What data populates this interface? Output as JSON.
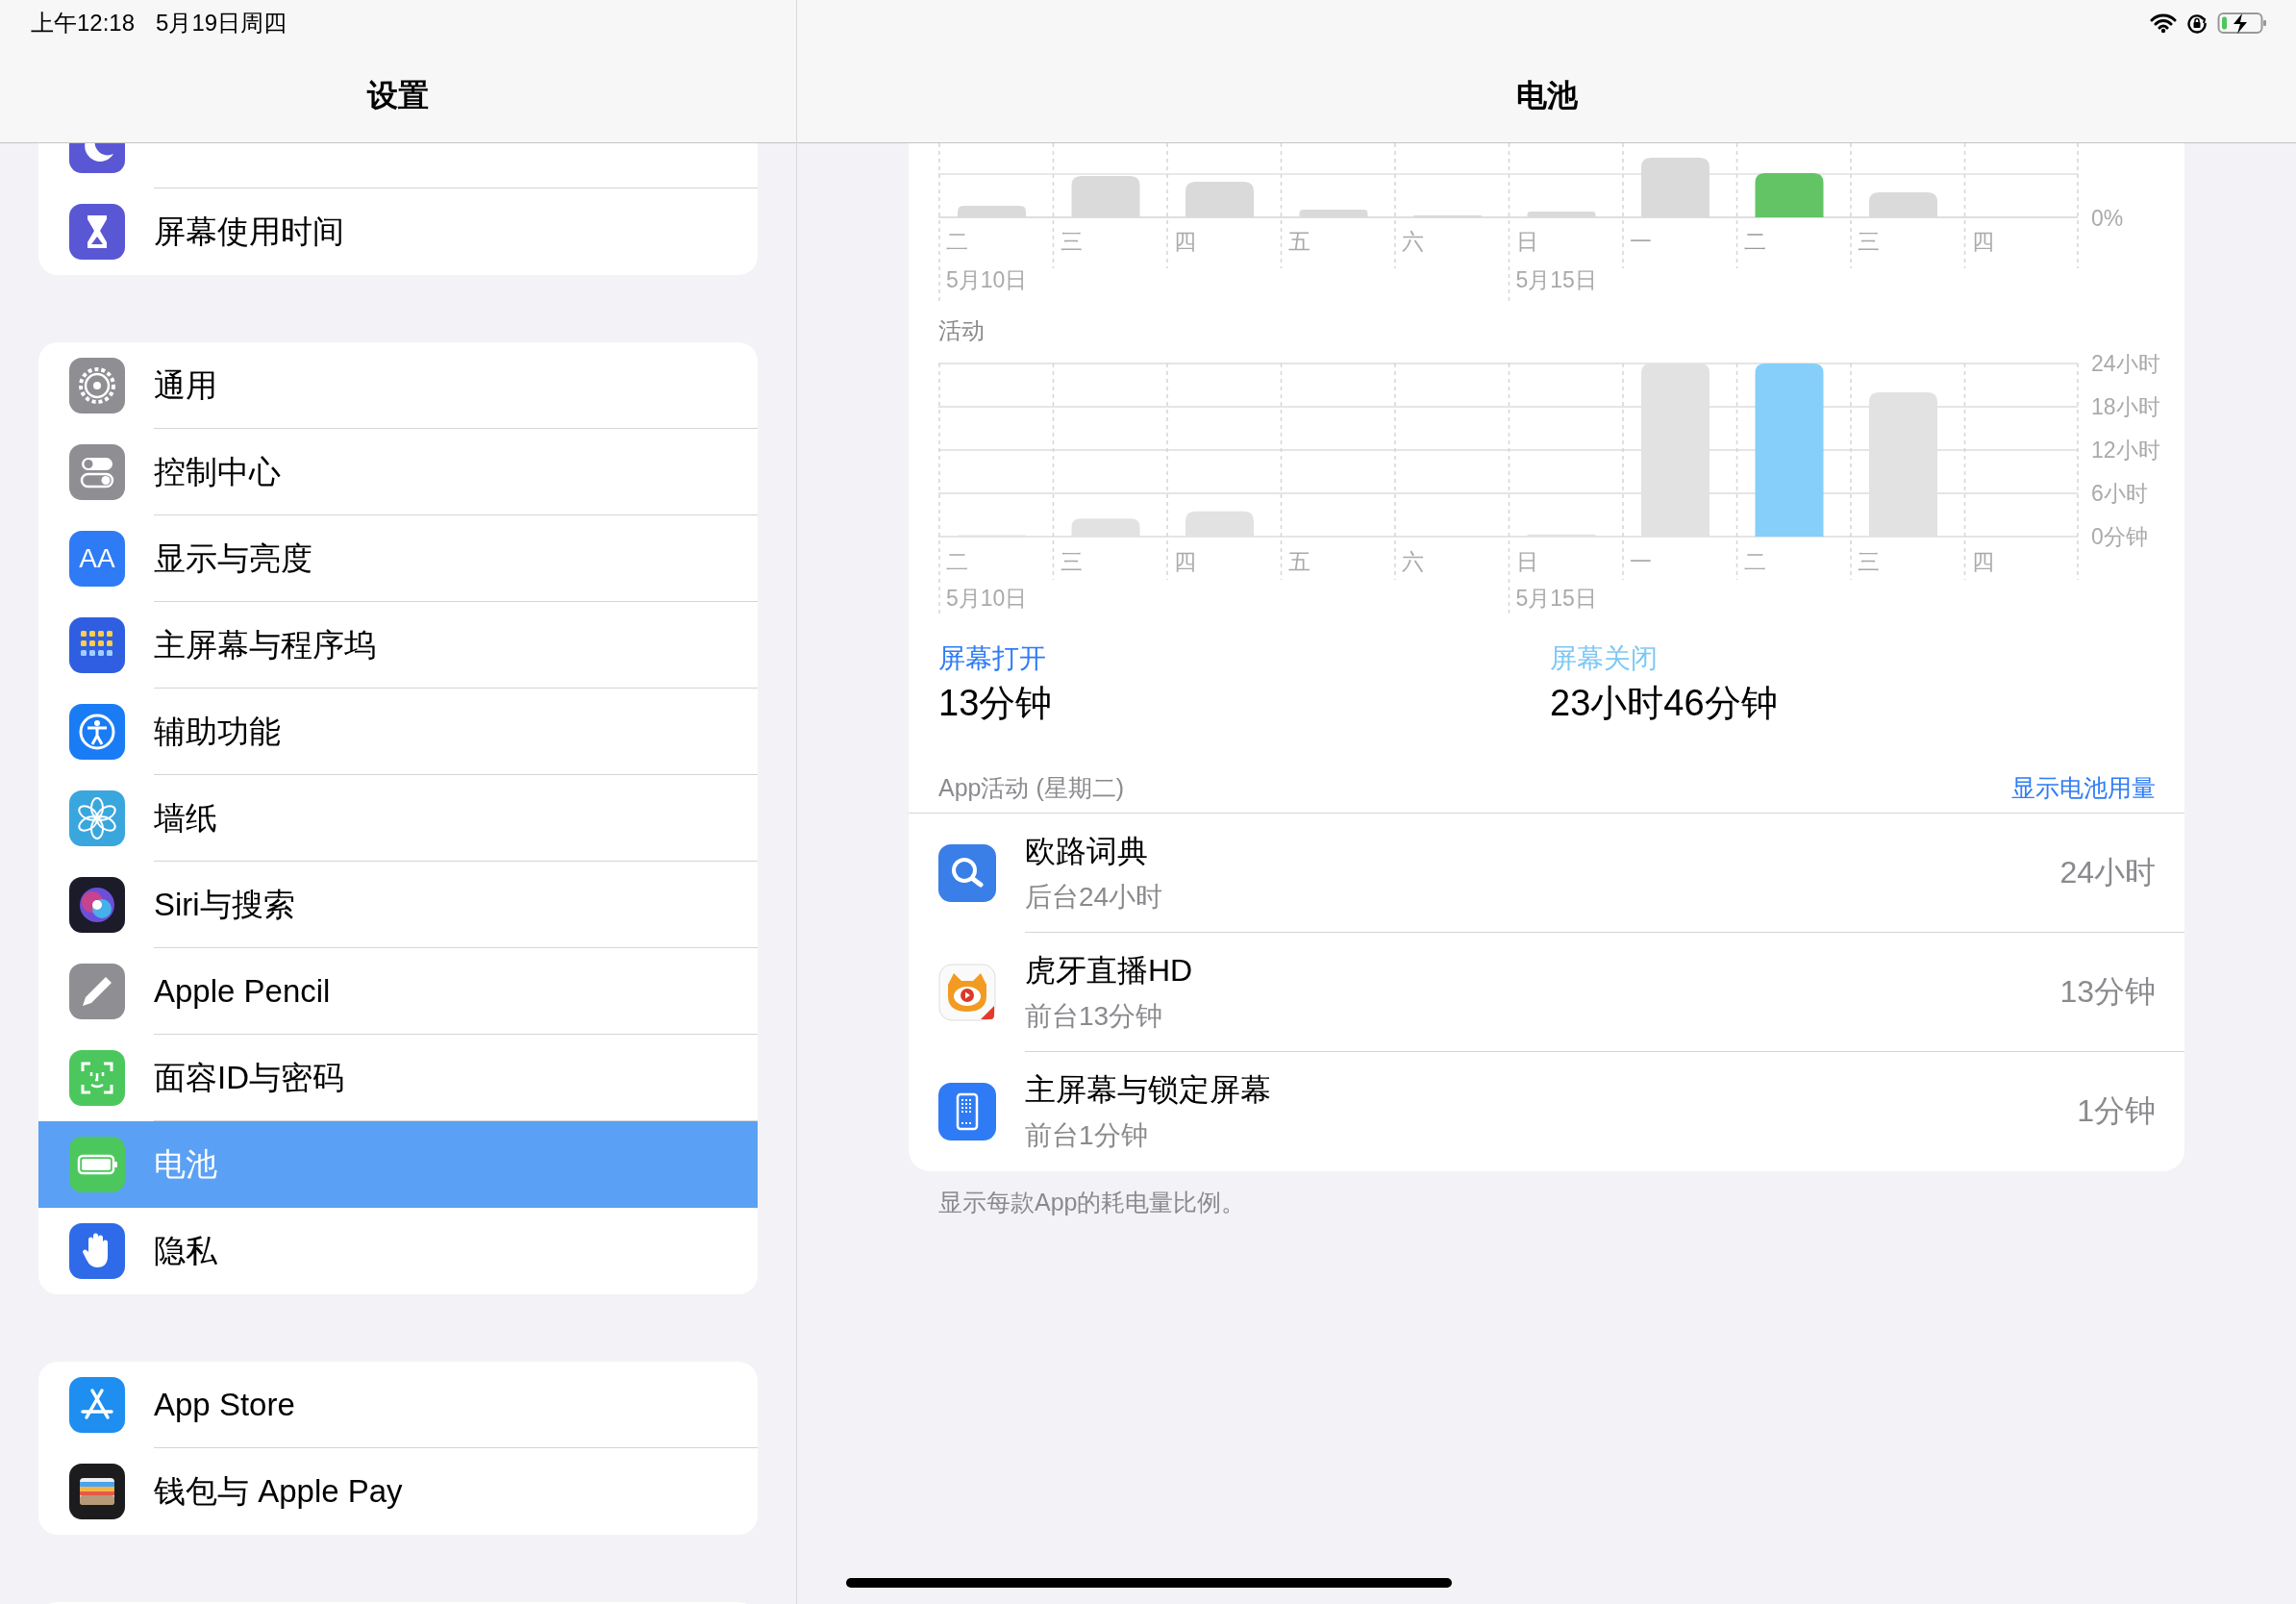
{
  "status_bar": {
    "time": "上午12:18",
    "date": "5月19日周四"
  },
  "sidebar": {
    "title": "设置",
    "groups": [
      {
        "items": [
          {
            "selected": false
          },
          {
            "label": "屏幕使用时间",
            "selected": false
          }
        ]
      },
      {
        "items": [
          {
            "label": "通用",
            "selected": false
          },
          {
            "label": "控制中心",
            "selected": false
          },
          {
            "label": "显示与亮度",
            "selected": false,
            "icon_text": "AA"
          },
          {
            "label": "主屏幕与程序坞",
            "selected": false
          },
          {
            "label": "辅助功能",
            "selected": false
          },
          {
            "label": "墙纸",
            "selected": false
          },
          {
            "label": "Siri与搜索",
            "selected": false
          },
          {
            "label": "Apple Pencil",
            "selected": false
          },
          {
            "label": "面容ID与密码",
            "selected": false
          },
          {
            "label": "电池",
            "selected": true
          },
          {
            "label": "隐私",
            "selected": false
          }
        ]
      },
      {
        "items": [
          {
            "label": "App Store",
            "selected": false
          },
          {
            "label": "钱包与 Apple Pay",
            "selected": false
          }
        ]
      }
    ]
  },
  "detail": {
    "title": "电池",
    "battery_chart": {
      "zero_label": "0%",
      "days": [
        {
          "label": "二",
          "selected": false
        },
        {
          "label": "三",
          "selected": false
        },
        {
          "label": "四",
          "selected": false
        },
        {
          "label": "五",
          "selected": false
        },
        {
          "label": "六",
          "selected": false
        },
        {
          "label": "日",
          "selected": false
        },
        {
          "label": "一",
          "selected": false
        },
        {
          "label": "二",
          "selected": true
        },
        {
          "label": "三",
          "selected": false
        },
        {
          "label": "四",
          "selected": false
        }
      ],
      "dates": [
        "5月10日",
        "5月15日"
      ]
    },
    "activity": {
      "title": "活动",
      "dates": [
        "5月10日",
        "5月15日"
      ],
      "chart_data": {
        "type": "bar",
        "grid": true,
        "categories": [
          "二",
          "三",
          "四",
          "五",
          "六",
          "日",
          "一",
          "二",
          "三",
          "四"
        ],
        "ylim": [
          0,
          24
        ],
        "values": [
          0.2,
          2.5,
          3.5,
          0,
          0,
          0.3,
          24,
          24,
          20,
          null
        ],
        "yticks": [
          {
            "value": 0,
            "label": "0分钟"
          },
          {
            "value": 6,
            "label": "6小时"
          },
          {
            "value": 12,
            "label": "12小时"
          },
          {
            "value": 18,
            "label": "18小时"
          },
          {
            "value": 24,
            "label": "24小时"
          }
        ]
      }
    },
    "summary": [
      {
        "label": "屏幕打开",
        "value": "13分钟",
        "color": "#2f7bf5"
      },
      {
        "label": "屏幕关闭",
        "value": "23小时46分钟",
        "color": "#7cc8f5"
      }
    ],
    "app_activity": {
      "header": "App活动 (星期二)",
      "link": "显示电池用量",
      "apps": [
        {
          "name": "欧路词典",
          "detail": "后台24小时",
          "value": "24小时"
        },
        {
          "name": "虎牙直播HD",
          "detail": "前台13分钟",
          "value": "13分钟"
        },
        {
          "name": "主屏幕与锁定屏幕",
          "detail": "前台1分钟",
          "value": "1分钟"
        }
      ]
    },
    "footnote": "显示每款App的耗电量比例。"
  }
}
